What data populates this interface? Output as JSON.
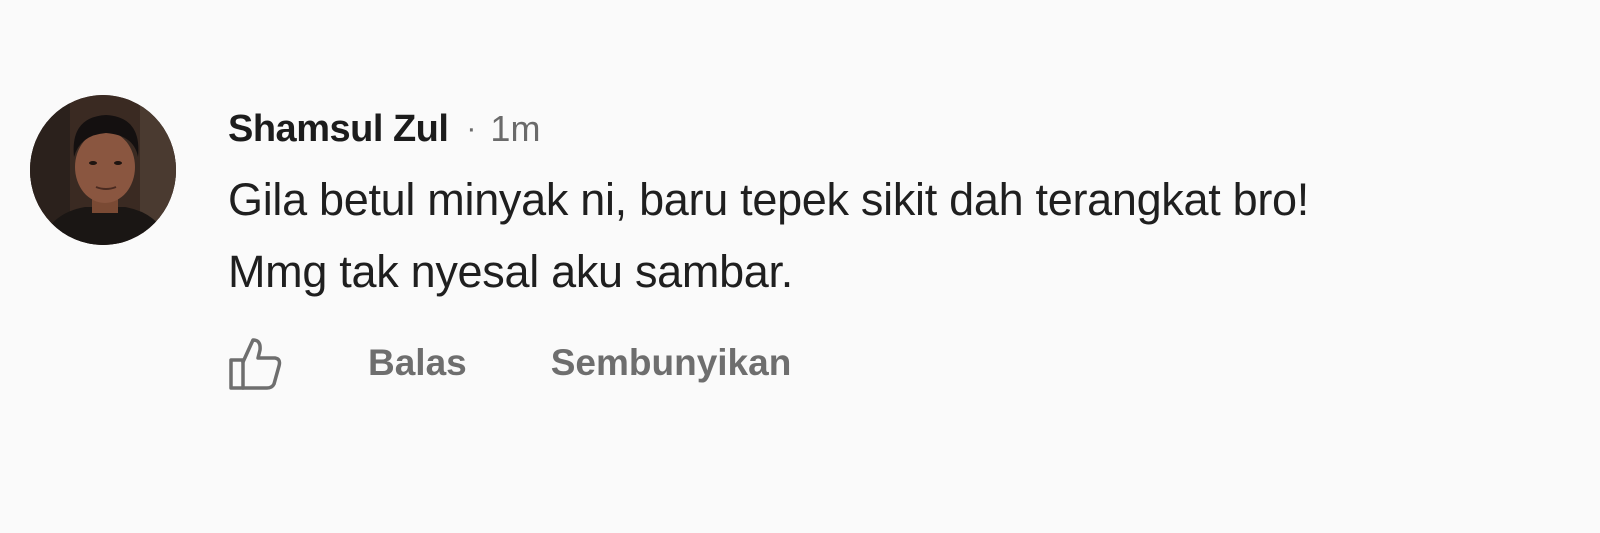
{
  "comment": {
    "author": "Shamsul Zul",
    "separator": "·",
    "timestamp": "1m",
    "text_line_1": "Gila betul minyak ni, baru tepek sikit dah terangkat bro!",
    "text_line_2": "Mmg tak nyesal aku sambar.",
    "avatar_icon": "profile-photo"
  },
  "actions": {
    "like_icon": "thumbs-up-icon",
    "reply_label": "Balas",
    "hide_label": "Sembunyikan"
  },
  "colors": {
    "background": "#fafafa",
    "author_text": "#1c1c1c",
    "body_text": "#1f1f1f",
    "muted_text": "#6e6e6e"
  }
}
